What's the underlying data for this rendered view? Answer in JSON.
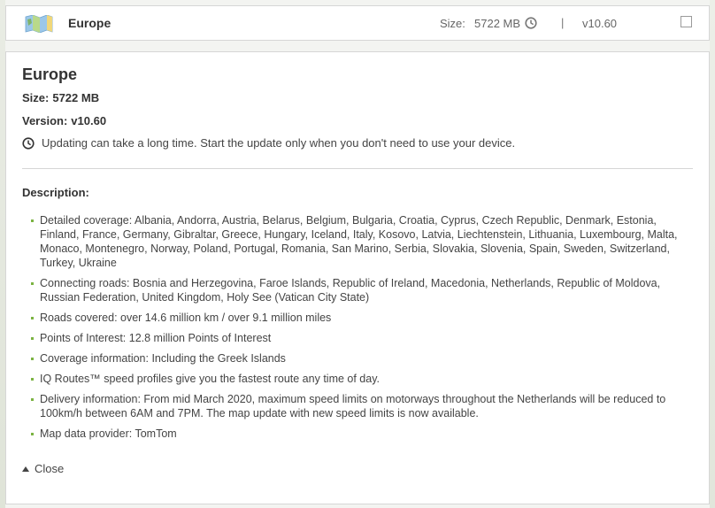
{
  "header": {
    "title": "Europe",
    "size_label": "Size:",
    "size_value": "5722 MB",
    "separator": "|",
    "version": "v10.60",
    "map_icon": "map-icon",
    "clock_icon": "clock-icon"
  },
  "details": {
    "title": "Europe",
    "size_label": "Size:",
    "size_value": "5722 MB",
    "version_label": "Version:",
    "version_value": "v10.60",
    "notice": "Updating can take a long time. Start the update only when you don't need to use your device.",
    "description_heading": "Description:",
    "items": [
      "Detailed coverage: Albania, Andorra, Austria, Belarus, Belgium, Bulgaria, Croatia, Cyprus, Czech Republic, Denmark, Estonia, Finland, France, Germany, Gibraltar, Greece, Hungary, Iceland, Italy, Kosovo, Latvia, Liechtenstein, Lithuania, Luxembourg, Malta, Monaco, Montenegro, Norway, Poland, Portugal, Romania, San Marino, Serbia, Slovakia, Slovenia, Spain, Sweden, Switzerland, Turkey, Ukraine",
      "Connecting roads: Bosnia and Herzegovina, Faroe Islands, Republic of Ireland, Macedonia, Netherlands, Republic of Moldova, Russian Federation, United Kingdom, Holy See (Vatican City State)",
      "Roads covered: over 14.6 million km / over 9.1 million miles",
      "Points of Interest: 12.8 million Points of Interest",
      "Coverage information: Including the Greek Islands",
      "IQ Routes™ speed profiles give you the fastest route any time of day.",
      "Delivery information: From mid March 2020, maximum speed limits on motorways throughout the Netherlands will be reduced to 100km/h between 6AM and 7PM. The map update with new speed limits is now available.",
      "Map data provider: TomTom"
    ],
    "close_label": "Close"
  },
  "colors": {
    "accent_bullet": "#7bb342",
    "text": "#333333",
    "border": "#d6d6d6"
  }
}
